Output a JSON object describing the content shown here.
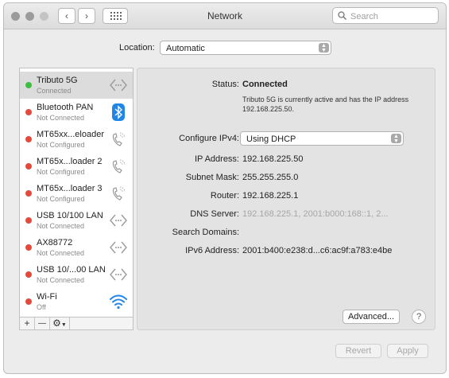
{
  "window": {
    "title": "Network",
    "back_glyph": "‹",
    "forward_glyph": "›",
    "search_placeholder": "Search",
    "search_icon": "magnifier-icon",
    "grid_icon": "grid-icon"
  },
  "location": {
    "label": "Location:",
    "value": "Automatic"
  },
  "services": [
    {
      "name": "Tributo 5G",
      "status": "Connected",
      "status_color": "#3fbf3f",
      "icon": "ethernet-arrows-icon",
      "selected": true
    },
    {
      "name": "Bluetooth PAN",
      "status": "Not Connected",
      "status_color": "#e24b3b",
      "icon": "bluetooth-icon",
      "selected": false
    },
    {
      "name": "MT65xx...eloader",
      "status": "Not Configured",
      "status_color": "#e24b3b",
      "icon": "phone-icon",
      "selected": false
    },
    {
      "name": "MT65x...loader 2",
      "status": "Not Configured",
      "status_color": "#e24b3b",
      "icon": "phone-icon",
      "selected": false
    },
    {
      "name": "MT65x...loader 3",
      "status": "Not Configured",
      "status_color": "#e24b3b",
      "icon": "phone-icon",
      "selected": false
    },
    {
      "name": "USB 10/100 LAN",
      "status": "Not Connected",
      "status_color": "#e24b3b",
      "icon": "ethernet-arrows-icon",
      "selected": false
    },
    {
      "name": "AX88772",
      "status": "Not Connected",
      "status_color": "#e24b3b",
      "icon": "ethernet-arrows-icon",
      "selected": false
    },
    {
      "name": "USB 10/...00 LAN",
      "status": "Not Connected",
      "status_color": "#e24b3b",
      "icon": "ethernet-arrows-icon",
      "selected": false
    },
    {
      "name": "Wi-Fi",
      "status": "Off",
      "status_color": "#e24b3b",
      "icon": "wifi-icon",
      "selected": false
    }
  ],
  "sidebar_buttons": {
    "add": "+",
    "remove": "—",
    "action": "⚙"
  },
  "detail": {
    "status_label": "Status:",
    "status_value": "Connected",
    "status_desc": "Tributo 5G is currently active and has the IP address 192.168.225.50.",
    "configure_label": "Configure IPv4:",
    "configure_value": "Using DHCP",
    "ip_label": "IP Address:",
    "ip_value": "192.168.225.50",
    "subnet_label": "Subnet Mask:",
    "subnet_value": "255.255.255.0",
    "router_label": "Router:",
    "router_value": "192.168.225.1",
    "dns_label": "DNS Server:",
    "dns_value": "192.168.225.1, 2001:b000:168::1, 2...",
    "search_domains_label": "Search Domains:",
    "ipv6_label": "IPv6 Address:",
    "ipv6_value": "2001:b400:e238:d...c6:ac9f:a783:e4be"
  },
  "buttons": {
    "advanced": "Advanced...",
    "help": "?",
    "revert": "Revert",
    "apply": "Apply"
  },
  "colors": {
    "selected_row": "#dcdcdc",
    "bluetooth_blue": "#1f86e8",
    "wifi_blue": "#1f86e8"
  }
}
